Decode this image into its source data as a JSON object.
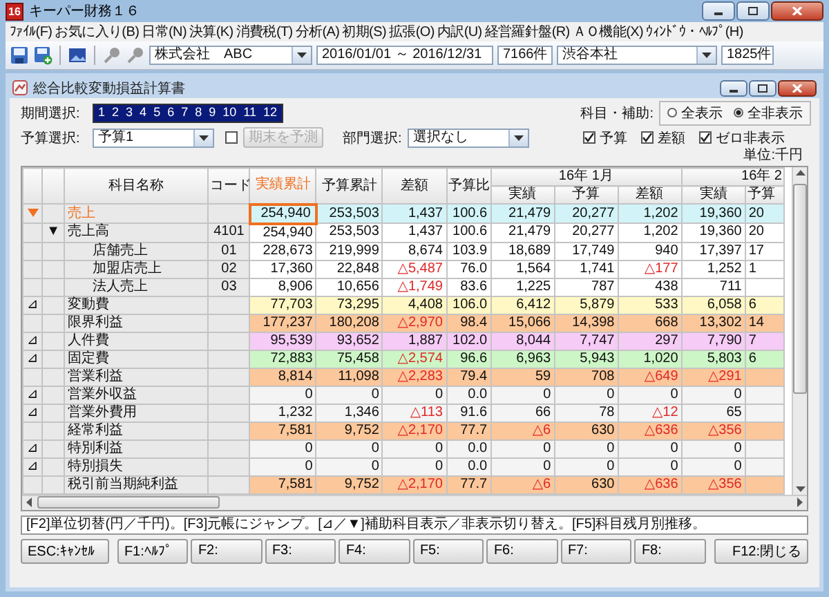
{
  "window": {
    "icon_text": "16",
    "title": "キーパー財務１６"
  },
  "menu": [
    "ﾌｧｲﾙ(F)",
    "お気に入り(B)",
    "日常(N)",
    "決算(K)",
    "消費税(T)",
    "分析(A)",
    "初期(S)",
    "拡張(O)",
    "内訳(U)",
    "経営羅針盤(R)",
    "ＡＯ機能(X)",
    "ｳｨﾝﾄﾞｳ・ﾍﾙﾌﾟ(H)"
  ],
  "toolbar": {
    "company": "株式会社　ABC",
    "period": "2016/01/01 ～ 2016/12/31",
    "count": "7166件",
    "branch": "渋谷本社",
    "branch_count": "1825件"
  },
  "report": {
    "title": "総合比較変動損益計算書",
    "period_label": "期間選択:",
    "months": [
      {
        "label": "1",
        "selected": true
      },
      {
        "label": "2",
        "selected": true
      },
      {
        "label": "3",
        "selected": true
      },
      {
        "label": "4",
        "selected": true
      },
      {
        "label": "5",
        "selected": true
      },
      {
        "label": "6",
        "selected": true
      },
      {
        "label": "7",
        "selected": true
      },
      {
        "label": "8",
        "selected": true
      },
      {
        "label": "9",
        "selected": true
      },
      {
        "label": "10",
        "selected": true
      },
      {
        "label": "11",
        "selected": true
      },
      {
        "label": "12",
        "selected": true
      }
    ],
    "budget_label": "予算選択:",
    "budget_value": "予算1",
    "forecast_checked": false,
    "forecast_button": {
      "label": "期末を予測",
      "disabled": true
    },
    "dept_label": "部門選択:",
    "dept_value": "選択なし",
    "subject_label": "科目・補助:",
    "radios": [
      {
        "label": "全表示",
        "selected": false
      },
      {
        "label": "全非表示",
        "selected": true
      }
    ],
    "checks": [
      {
        "label": "予算",
        "checked": true
      },
      {
        "label": "差額",
        "checked": true
      },
      {
        "label": "ゼロ非表示",
        "checked": true
      }
    ],
    "unit": "単位:千円"
  },
  "table": {
    "columns": [
      {
        "label": "科目名称",
        "selected": false
      },
      {
        "label": "コード",
        "selected": false
      },
      {
        "label": "実績累計",
        "selected": true
      },
      {
        "label": "予算累計",
        "selected": false
      },
      {
        "label": "差額",
        "selected": false
      },
      {
        "label": "予算比",
        "selected": false
      }
    ],
    "groups": [
      {
        "label": "16年 1月",
        "columns": [
          "実績",
          "予算",
          "差額"
        ]
      },
      {
        "label": "16年 2",
        "columns": [
          "実績",
          "予算"
        ]
      }
    ],
    "rows": [
      {
        "current": true,
        "name": "売上",
        "color": "#d2f4f9",
        "values": [
          "254,940",
          "253,503",
          "1,437",
          "100.6",
          "21,479",
          "20,277",
          "1,202",
          "19,360",
          "20"
        ]
      },
      {
        "current": false,
        "expander": "▼",
        "name": "売上高",
        "code": "4101",
        "color": "#ffffff",
        "values": [
          "254,940",
          "253,503",
          "1,437",
          "100.6",
          "21,479",
          "20,277",
          "1,202",
          "19,360",
          "20"
        ],
        "children": [
          {
            "current": false,
            "name": "店舗売上",
            "code": "01",
            "color": "#ffffff",
            "values": [
              "228,673",
              "219,999",
              "8,674",
              "103.9",
              "18,689",
              "17,749",
              "940",
              "17,397",
              "17"
            ]
          },
          {
            "current": false,
            "name": "加盟店売上",
            "code": "02",
            "color": "#ffffff",
            "values": [
              "17,360",
              "22,848",
              {
                "text": "△5,487",
                "negative": true
              },
              "76.0",
              "1,564",
              "1,741",
              {
                "text": "△177",
                "negative": true
              },
              "1,252",
              "1"
            ]
          },
          {
            "current": false,
            "name": "法人売上",
            "code": "03",
            "color": "#ffffff",
            "values": [
              "8,906",
              "10,656",
              {
                "text": "△1,749",
                "negative": true
              },
              "83.6",
              "1,225",
              "787",
              "438",
              "711"
            ]
          }
        ]
      },
      {
        "current": false,
        "toggle": "⊿",
        "name": "変動費",
        "color": "#fff8c4",
        "values": [
          "77,703",
          "73,295",
          "4,408",
          "106.0",
          "6,412",
          "5,879",
          "533",
          "6,058",
          "6"
        ]
      },
      {
        "current": false,
        "name": "限界利益",
        "color": "#fcc79a",
        "values": [
          "177,237",
          "180,208",
          {
            "text": "△2,970",
            "negative": true
          },
          "98.4",
          "15,066",
          "14,398",
          "668",
          "13,302",
          "14"
        ]
      },
      {
        "current": false,
        "toggle": "⊿",
        "name": "人件費",
        "color": "#f6ccf6",
        "values": [
          "95,539",
          "93,652",
          "1,887",
          "102.0",
          "8,044",
          "7,747",
          "297",
          "7,790",
          "7"
        ]
      },
      {
        "current": false,
        "toggle": "⊿",
        "name": "固定費",
        "color": "#cdf6c6",
        "values": [
          "72,883",
          "75,458",
          {
            "text": "△2,574",
            "negative": true
          },
          "96.6",
          "6,963",
          "5,943",
          "1,020",
          "5,803",
          "6"
        ]
      },
      {
        "current": false,
        "name": "営業利益",
        "color": "#fcc79a",
        "values": [
          "8,814",
          "11,098",
          {
            "text": "△2,283",
            "negative": true
          },
          "79.4",
          "59",
          "708",
          {
            "text": "△649",
            "negative": true
          },
          {
            "text": "△291",
            "negative": true
          }
        ]
      },
      {
        "current": false,
        "toggle": "⊿",
        "name": "営業外収益",
        "color": "#f4f4f4",
        "values": [
          "0",
          "0",
          "0",
          "0.0",
          "0",
          "0",
          "0",
          "0"
        ]
      },
      {
        "current": false,
        "toggle": "⊿",
        "name": "営業外費用",
        "color": "#f4f4f4",
        "values": [
          "1,232",
          "1,346",
          {
            "text": "△113",
            "negative": true
          },
          "91.6",
          "66",
          "78",
          {
            "text": "△12",
            "negative": true
          },
          "65"
        ]
      },
      {
        "current": false,
        "name": "経常利益",
        "color": "#fcc79a",
        "values": [
          "7,581",
          "9,752",
          {
            "text": "△2,170",
            "negative": true
          },
          "77.7",
          {
            "text": "△6",
            "negative": true
          },
          "630",
          {
            "text": "△636",
            "negative": true
          },
          {
            "text": "△356",
            "negative": true
          }
        ]
      },
      {
        "current": false,
        "toggle": "⊿",
        "name": "特別利益",
        "color": "#f4f4f4",
        "values": [
          "0",
          "0",
          "0",
          "0.0",
          "0",
          "0",
          "0",
          "0"
        ]
      },
      {
        "current": false,
        "toggle": "⊿",
        "name": "特別損失",
        "color": "#f4f4f4",
        "values": [
          "0",
          "0",
          "0",
          "0.0",
          "0",
          "0",
          "0",
          "0"
        ]
      },
      {
        "current": false,
        "name": "税引前当期純利益",
        "color": "#fcc79a",
        "values": [
          "7,581",
          "9,752",
          {
            "text": "△2,170",
            "negative": true
          },
          "77.7",
          {
            "text": "△6",
            "negative": true
          },
          "630",
          {
            "text": "△636",
            "negative": true
          },
          {
            "text": "△356",
            "negative": true
          }
        ]
      }
    ]
  },
  "hint": "[F2]単位切替(円／千円)。[F3]元帳にジャンプ。[⊿／▼]補助科目表示／非表示切り替え。[F5]科目残月別推移。",
  "function_keys": [
    "ESC:ｷｬﾝｾﾙ",
    "F1:ﾍﾙﾌﾟ",
    "F2:",
    "F3:",
    "F4:",
    "F5:",
    "F6:",
    "F7:",
    "F8:",
    "F12:閉じる"
  ]
}
